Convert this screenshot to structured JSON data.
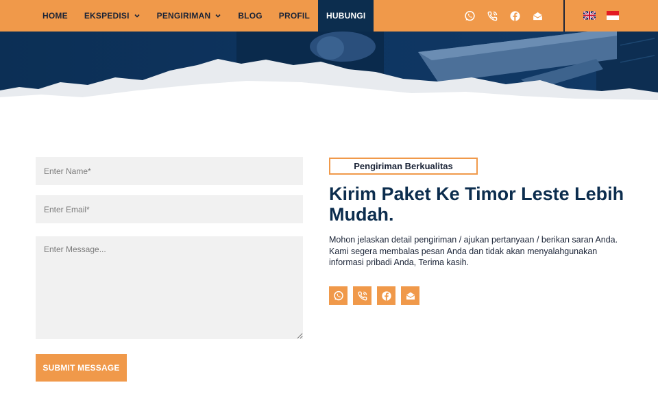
{
  "nav": {
    "items": [
      {
        "label": "HOME",
        "has_dropdown": false,
        "active": false
      },
      {
        "label": "EKSPEDISI",
        "has_dropdown": true,
        "active": false
      },
      {
        "label": "PENGIRIMAN",
        "has_dropdown": true,
        "active": false
      },
      {
        "label": "BLOG",
        "has_dropdown": false,
        "active": false
      },
      {
        "label": "PROFIL",
        "has_dropdown": false,
        "active": false
      },
      {
        "label": "HUBUNGI",
        "has_dropdown": false,
        "active": true
      }
    ],
    "icons": [
      "whatsapp-icon",
      "phone-icon",
      "facebook-icon",
      "email-icon"
    ],
    "flags": [
      "uk-flag-icon",
      "indonesia-flag-icon"
    ]
  },
  "form": {
    "name_placeholder": "Enter Name*",
    "email_placeholder": "Enter Email*",
    "message_placeholder": "Enter Message...",
    "submit_label": "SUBMIT MESSAGE"
  },
  "content": {
    "tag": "Pengiriman Berkualitas",
    "headline": "Kirim Paket Ke Timor Leste Lebih Mudah.",
    "description": "Mohon jelaskan detail pengiriman / ajukan pertanyaan / berikan saran Anda. Kami segera membalas pesan Anda dan tidak akan menyalahgunakan informasi pribadi Anda, Terima kasih.",
    "social_icons": [
      "whatsapp-icon",
      "phone-icon",
      "facebook-icon",
      "email-icon"
    ]
  },
  "colors": {
    "accent": "#f0994a",
    "navy": "#0c2d4e",
    "dark_text": "#1a2336",
    "field_bg": "#f1f1f1"
  }
}
